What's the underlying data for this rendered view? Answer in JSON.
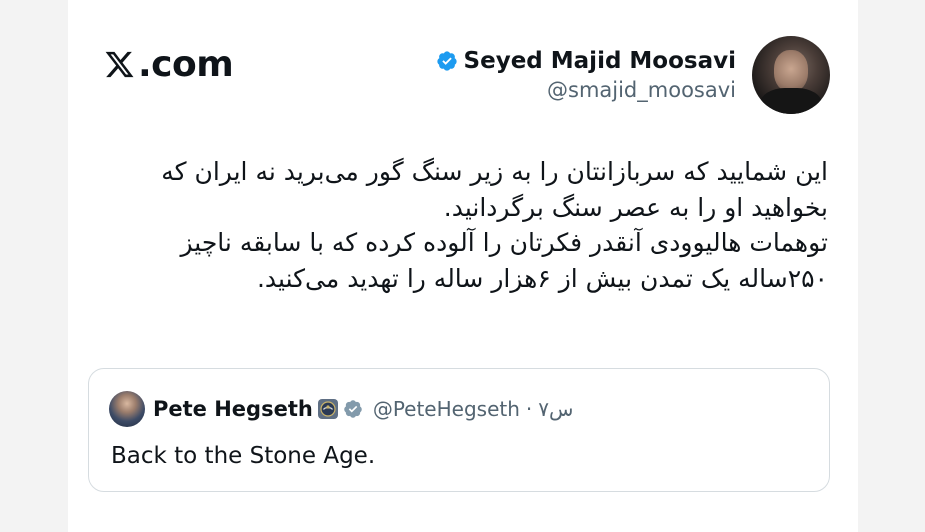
{
  "brand": {
    "domain": ".com",
    "icon": "x-logo-icon"
  },
  "author": {
    "name": "Seyed Majid Moosavi",
    "handle": "@smajid_moosavi",
    "verified_color": "#1d9bf0"
  },
  "tweet": {
    "text": "این شمایید که سربازانتان را به زیر سنگ گور می‌برید نه ایران که بخواهید او را به عصر سنگ برگردانید.\nتوهمات هالیوودی آنقدر فکرتان را آلوده کرده که با سابقه ناچیز ۲۵۰ساله یک تمدن بیش از ۶هزار ساله را تهدید می‌کنید."
  },
  "quoted_tweet": {
    "name": "Pete Hegseth",
    "handle": "@PeteHegseth",
    "separator": "·",
    "time": "۷س",
    "text": "Back to the Stone Age.",
    "badges": [
      "government-badge-icon",
      "verified-icon"
    ]
  }
}
